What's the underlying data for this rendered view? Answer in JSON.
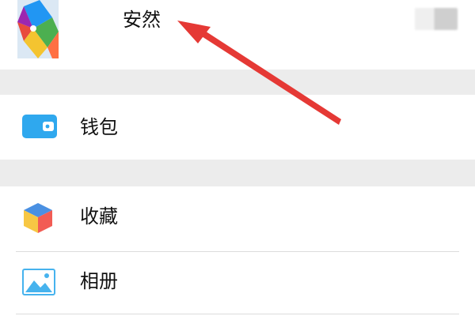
{
  "profile": {
    "name": "安然",
    "avatar_icon": "pinwheel-avatar"
  },
  "menu": {
    "wallet": {
      "label": "钱包",
      "icon": "wallet-icon",
      "icon_color": "#2fa8ee"
    },
    "favorites": {
      "label": "收藏",
      "icon": "favorites-cube-icon",
      "icon_colors": [
        "#f25c54",
        "#f7c744",
        "#4a90e2"
      ]
    },
    "album": {
      "label": "相册",
      "icon": "album-icon",
      "icon_color": "#46b3ee"
    }
  },
  "annotation": {
    "icon": "red-arrow-annotation",
    "color": "#e53935"
  },
  "colors": {
    "section_gap": "#ececec",
    "divider": "#dcdcdc"
  }
}
